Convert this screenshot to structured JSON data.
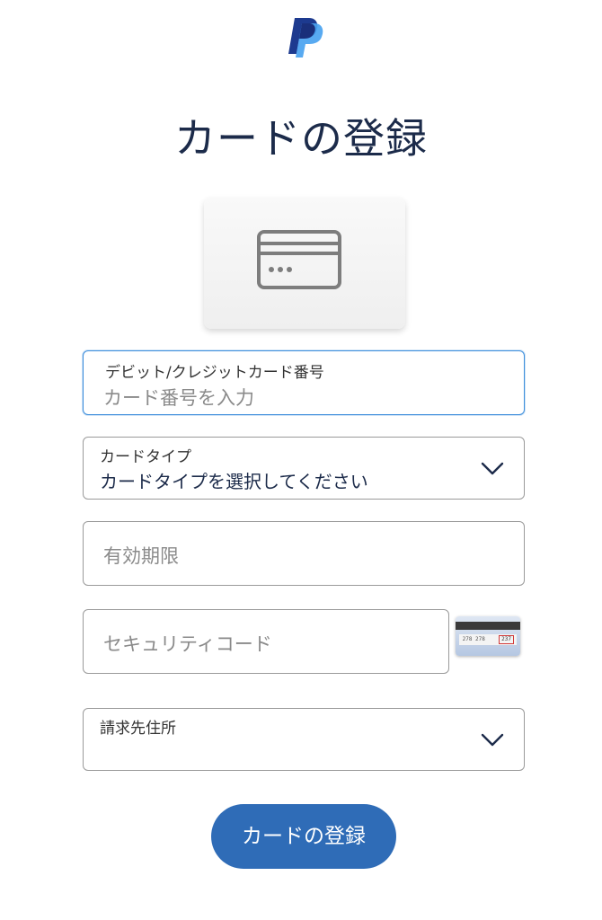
{
  "brand": {
    "logo_icon": "paypal-logo-icon",
    "colors": {
      "dark": "#1d3a8f",
      "light": "#4aa3f0"
    }
  },
  "title": "カードの登録",
  "card_icon": "credit-card-icon",
  "fields": {
    "card_number": {
      "label": "デビット/クレジットカード番号",
      "placeholder": "カード番号を入力",
      "focused": true
    },
    "card_type": {
      "label": "カードタイプ",
      "value": "カードタイプを選択してください",
      "icon": "chevron-down-icon"
    },
    "expiry": {
      "placeholder": "有効期限"
    },
    "security_code": {
      "placeholder": "セキュリティコード",
      "hint_icon": "card-back-cvv-icon"
    },
    "billing_address": {
      "label": "請求先住所",
      "icon": "chevron-down-icon"
    }
  },
  "submit_label": "カードの登録",
  "colors": {
    "title": "#1c2b4a",
    "focus_border": "#3f8fdc",
    "border": "#9a9a9a",
    "button": "#2f6cb7"
  }
}
